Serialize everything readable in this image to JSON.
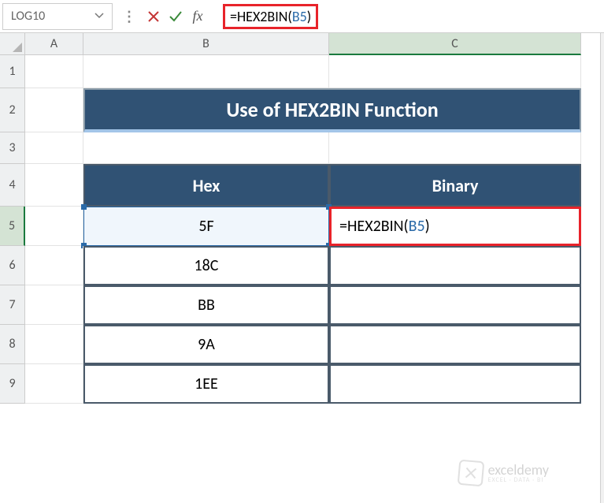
{
  "nameBox": "LOG10",
  "formulaBar": {
    "prefix": "=HEX2BIN(",
    "ref": "B5",
    "suffix": ")"
  },
  "columns": [
    "A",
    "B",
    "C"
  ],
  "rows": [
    "1",
    "2",
    "3",
    "4",
    "5",
    "6",
    "7",
    "8",
    "9"
  ],
  "title": "Use of HEX2BIN Function",
  "tableHeaders": {
    "hex": "Hex",
    "binary": "Binary"
  },
  "chart_data": {
    "type": "table",
    "columns": [
      "Hex",
      "Binary"
    ],
    "rows": [
      {
        "hex": "5F",
        "binary": "=HEX2BIN(B5)"
      },
      {
        "hex": "18C",
        "binary": ""
      },
      {
        "hex": "BB",
        "binary": ""
      },
      {
        "hex": "9A",
        "binary": ""
      },
      {
        "hex": "1EE",
        "binary": ""
      }
    ]
  },
  "activeCellFormula": {
    "prefix": "=HEX2BIN(",
    "ref": "B5",
    "suffix": ")"
  },
  "watermark": {
    "title": "exceldemy",
    "subtitle": "EXCEL · DATA · BI"
  },
  "dimensions": {
    "colA": 74,
    "colB": 312,
    "colC": 320,
    "row1": 42,
    "row2": 56,
    "row3": 40,
    "row4": 54,
    "rowData": 50
  }
}
